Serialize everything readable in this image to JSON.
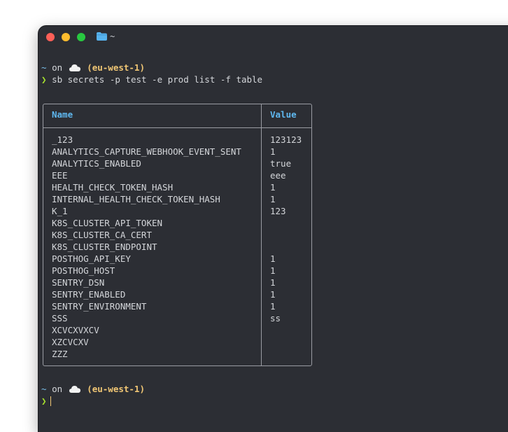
{
  "window": {
    "title": "~"
  },
  "prompt1": {
    "path": "~",
    "on": "on",
    "region": "(eu-west-1)",
    "command": "sb secrets -p test -e prod list -f table"
  },
  "table": {
    "headers": {
      "name": "Name",
      "value": "Value"
    },
    "rows": [
      {
        "name": "_123",
        "value": "123123"
      },
      {
        "name": "ANALYTICS_CAPTURE_WEBHOOK_EVENT_SENT",
        "value": "1"
      },
      {
        "name": "ANALYTICS_ENABLED",
        "value": "true"
      },
      {
        "name": "EEE",
        "value": "eee"
      },
      {
        "name": "HEALTH_CHECK_TOKEN_HASH",
        "value": "1"
      },
      {
        "name": "INTERNAL_HEALTH_CHECK_TOKEN_HASH",
        "value": "1"
      },
      {
        "name": "K_1",
        "value": "123"
      },
      {
        "name": "K8S_CLUSTER_API_TOKEN",
        "value": ""
      },
      {
        "name": "K8S_CLUSTER_CA_CERT",
        "value": ""
      },
      {
        "name": "K8S_CLUSTER_ENDPOINT",
        "value": ""
      },
      {
        "name": "POSTHOG_API_KEY",
        "value": "1"
      },
      {
        "name": "POSTHOG_HOST",
        "value": "1"
      },
      {
        "name": "SENTRY_DSN",
        "value": "1"
      },
      {
        "name": "SENTRY_ENABLED",
        "value": "1"
      },
      {
        "name": "SENTRY_ENVIRONMENT",
        "value": "1"
      },
      {
        "name": "SSS",
        "value": "ss"
      },
      {
        "name": "XCVCXVXCV",
        "value": ""
      },
      {
        "name": "XZCVCXV",
        "value": ""
      },
      {
        "name": "ZZZ",
        "value": ""
      }
    ]
  },
  "prompt2": {
    "path": "~",
    "on": "on",
    "region": "(eu-west-1)"
  },
  "colors": {
    "background": "#2c2e34",
    "text": "#d4d6da",
    "header": "#5fb8f0",
    "region": "#f0c674",
    "prompt_chevron": "#a6e22e"
  },
  "icons": [
    "close-icon",
    "minimize-icon",
    "maximize-icon",
    "folder-icon",
    "cloud-icon",
    "chevron-right-icon"
  ]
}
